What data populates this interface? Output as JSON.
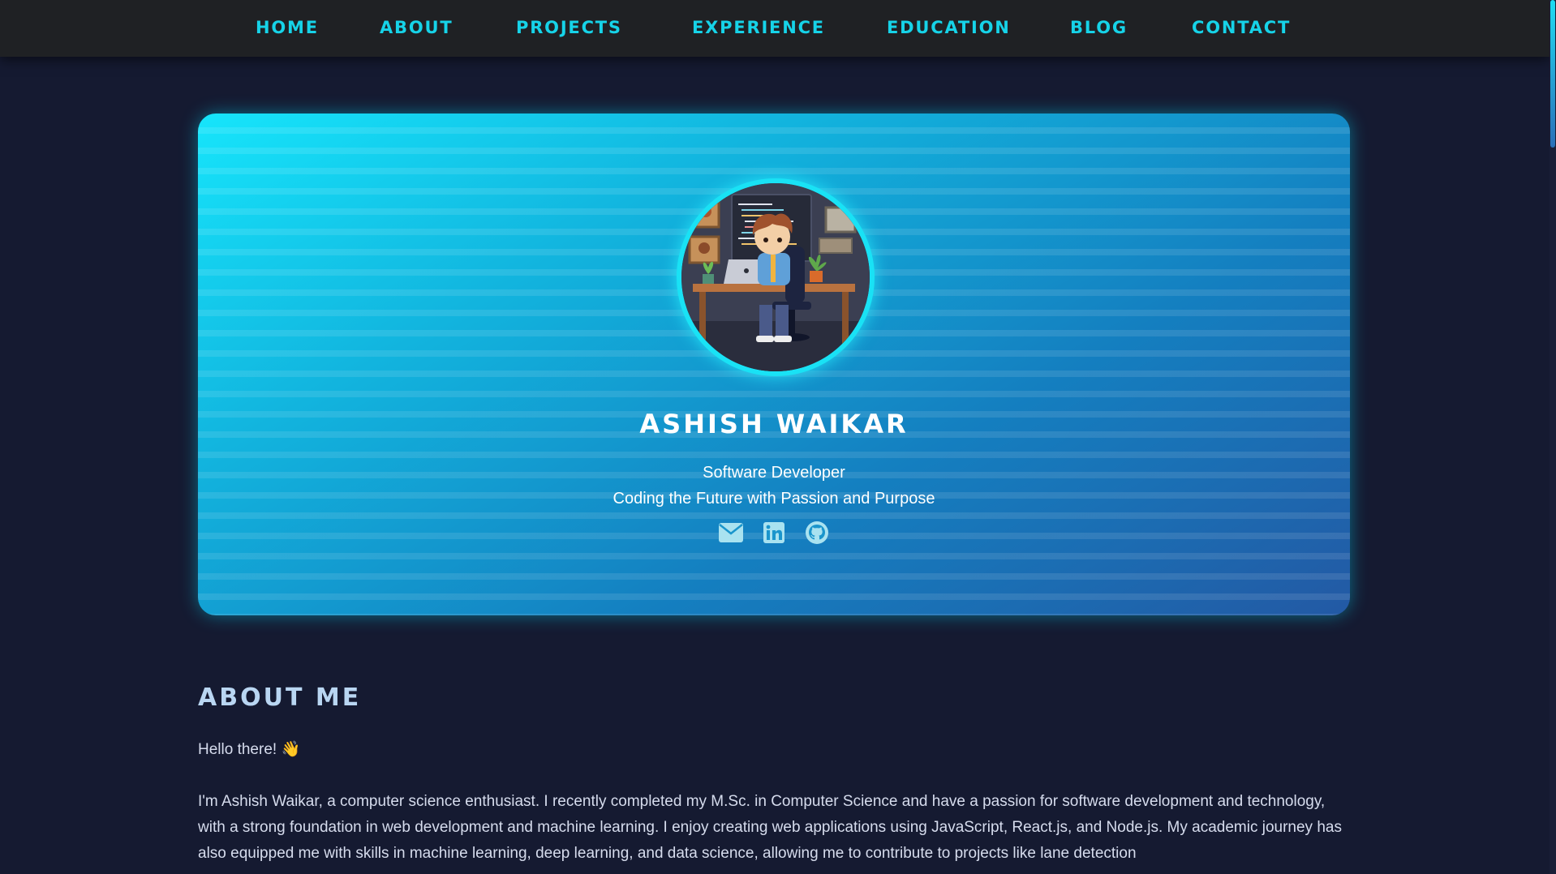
{
  "nav": {
    "items": [
      {
        "label": "HOME"
      },
      {
        "label": "ABOUT"
      },
      {
        "label": "PROJECTS"
      },
      {
        "label": "EXPERIENCE"
      },
      {
        "label": "EDUCATION"
      },
      {
        "label": "BLOG"
      },
      {
        "label": "CONTACT"
      }
    ]
  },
  "hero": {
    "name": "ASHISH WAIKAR",
    "role": "Software Developer",
    "tagline": "Coding the Future with Passion and Purpose",
    "social_icons": [
      "envelope-icon",
      "linkedin-icon",
      "github-icon"
    ]
  },
  "about": {
    "title": "ABOUT ME",
    "greeting": "Hello there! 👋",
    "body": "I'm Ashish Waikar, a computer science enthusiast. I recently completed my M.Sc. in Computer Science and have a passion for software development and technology, with a strong foundation in web development and machine learning. I enjoy creating web applications using JavaScript, React.js, and Node.js. My academic journey has also equipped me with skills in machine learning, deep learning, and data science, allowing me to contribute to projects like lane detection"
  },
  "colors": {
    "background": "#151a31",
    "navbar": "#1f2124",
    "accent": "#16d3e8",
    "heading": "#b9d6f2",
    "text": "#d6dced"
  }
}
